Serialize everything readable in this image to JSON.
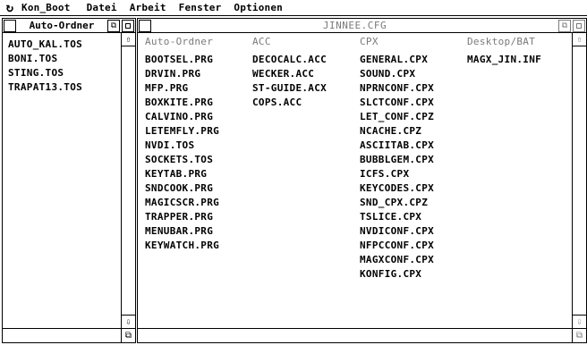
{
  "menubar": {
    "logo_glyph": "↻",
    "items": [
      "Kon_Boot",
      "Datei",
      "Arbeit",
      "Fenster",
      "Optionen"
    ]
  },
  "left_window": {
    "title": "Auto-Ordner",
    "files": [
      "AUTO_KAL.TOS",
      "BONI.TOS",
      "STING.TOS",
      "TRAPAT13.TOS"
    ]
  },
  "right_window": {
    "title": "JINNEE.CFG",
    "columns": [
      {
        "header": "Auto-Ordner",
        "files": [
          "BOOTSEL.PRG",
          "DRVIN.PRG",
          "MFP.PRG",
          "BOXKITE.PRG",
          "CALVINO.PRG",
          "LETEMFLY.PRG",
          "NVDI.TOS",
          "SOCKETS.TOS",
          "KEYTAB.PRG",
          "SNDCOOK.PRG",
          "MAGICSCR.PRG",
          "TRAPPER.PRG",
          "MENUBAR.PRG",
          "KEYWATCH.PRG"
        ]
      },
      {
        "header": "ACC",
        "files": [
          "DECOCALC.ACC",
          "WECKER.ACC",
          "ST-GUIDE.ACX",
          "COPS.ACC"
        ]
      },
      {
        "header": "CPX",
        "files": [
          "GENERAL.CPX",
          "SOUND.CPX",
          "NPRNCONF.CPX",
          "SLCTCONF.CPX",
          "LET_CONF.CPZ",
          "NCACHE.CPZ",
          "ASCIITAB.CPX",
          "BUBBLGEM.CPX",
          "ICFS.CPX",
          "KEYCODES.CPX",
          "SND_CPX.CPZ",
          "TSLICE.CPX",
          "NVDICONF.CPX",
          "NFPCCONF.CPX",
          "MAGXCONF.CPX",
          "KONFIG.CPX"
        ]
      },
      {
        "header": "Desktop/BAT",
        "files": [
          "MAGX_JIN.INF"
        ]
      }
    ]
  },
  "icons": {
    "scroll_up": "⇧",
    "scroll_down": "⇩",
    "size_box": "⧉"
  }
}
